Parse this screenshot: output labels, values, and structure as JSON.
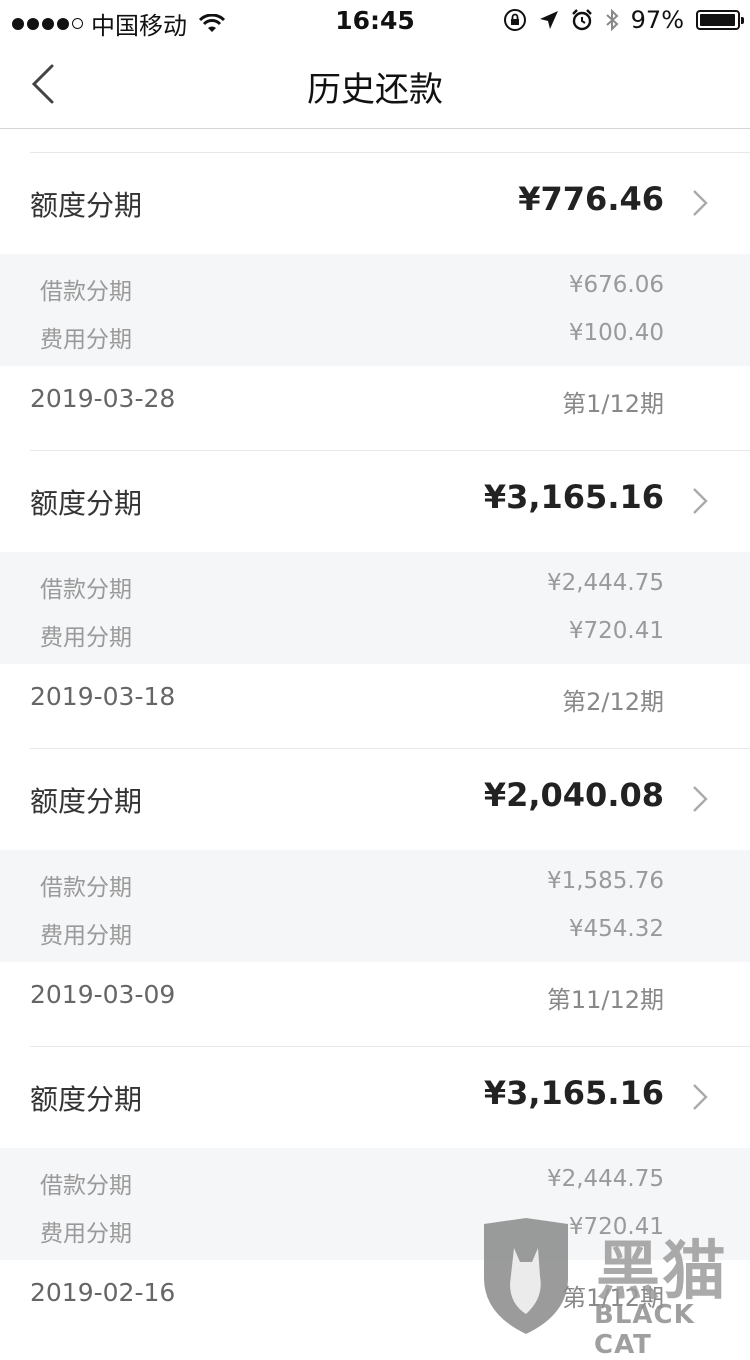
{
  "status_bar": {
    "carrier": "中国移动",
    "time": "16:45",
    "battery": "97%",
    "battery_level": 0.97
  },
  "nav": {
    "title": "历史还款"
  },
  "records": [
    {
      "label": "额度分期",
      "amount": "¥776.46",
      "details": [
        {
          "key": "借款分期",
          "value": "¥676.06"
        },
        {
          "key": "费用分期",
          "value": "¥100.40"
        }
      ],
      "date": "2019-03-28",
      "period": "第1/12期"
    },
    {
      "label": "额度分期",
      "amount": "¥3,165.16",
      "details": [
        {
          "key": "借款分期",
          "value": "¥2,444.75"
        },
        {
          "key": "费用分期",
          "value": "¥720.41"
        }
      ],
      "date": "2019-03-18",
      "period": "第2/12期"
    },
    {
      "label": "额度分期",
      "amount": "¥2,040.08",
      "details": [
        {
          "key": "借款分期",
          "value": "¥1,585.76"
        },
        {
          "key": "费用分期",
          "value": "¥454.32"
        }
      ],
      "date": "2019-03-09",
      "period": "第11/12期"
    },
    {
      "label": "额度分期",
      "amount": "¥3,165.16",
      "details": [
        {
          "key": "借款分期",
          "value": "¥2,444.75"
        },
        {
          "key": "费用分期",
          "value": "¥720.41"
        }
      ],
      "date": "2019-02-16",
      "period": "第1/12期"
    }
  ],
  "watermark": {
    "cn": "黑猫",
    "en": "BLACK CAT"
  }
}
